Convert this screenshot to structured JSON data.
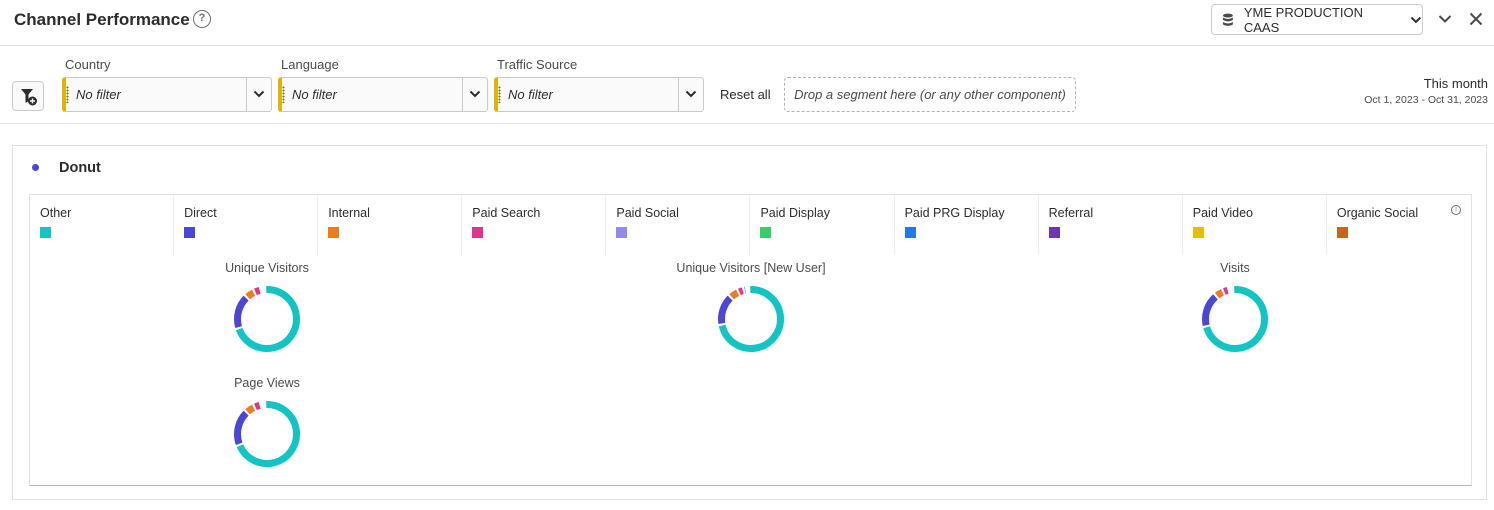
{
  "header": {
    "title": "Channel Performance",
    "help_glyph": "?",
    "datasource_label": "YME PRODUCTION CAAS"
  },
  "filters": {
    "items": [
      {
        "label": "Country",
        "value": "No filter"
      },
      {
        "label": "Language",
        "value": "No filter"
      },
      {
        "label": "Traffic Source",
        "value": "No filter"
      }
    ],
    "reset_label": "Reset all",
    "drop_zone": "Drop a segment here (or any other component)",
    "date_title": "This month",
    "date_range": "Oct 1, 2023 - Oct 31, 2023"
  },
  "panel": {
    "title": "Donut",
    "accent_color": "#4b47d6"
  },
  "legend": [
    {
      "label": "Other",
      "color": "#12c4c4"
    },
    {
      "label": "Direct",
      "color": "#4b47d6"
    },
    {
      "label": "Internal",
      "color": "#ec7d1f"
    },
    {
      "label": "Paid Search",
      "color": "#e0338a"
    },
    {
      "label": "Paid Social",
      "color": "#9389f5"
    },
    {
      "label": "Paid Display",
      "color": "#35d065"
    },
    {
      "label": "Paid PRG Display",
      "color": "#2479e8"
    },
    {
      "label": "Referral",
      "color": "#7134b3"
    },
    {
      "label": "Paid Video",
      "color": "#e3bf00"
    },
    {
      "label": "Organic Social",
      "color": "#c96516"
    }
  ],
  "info_glyph": "i",
  "chart_data": [
    {
      "type": "pie",
      "title": "Unique Visitors",
      "categories": [
        "Other",
        "Direct",
        "Internal",
        "Paid Search",
        "Paid Social",
        "Paid Display",
        "Paid PRG Display",
        "Referral",
        "Paid Video",
        "Organic Social"
      ],
      "values": [
        71,
        18,
        5,
        3.5,
        1,
        0.5,
        0.4,
        0.3,
        0.2,
        0.1
      ]
    },
    {
      "type": "pie",
      "title": "Unique Visitors [New User]",
      "categories": [
        "Other",
        "Direct",
        "Internal",
        "Paid Search",
        "Paid Social",
        "Paid Display",
        "Paid PRG Display",
        "Referral",
        "Paid Video",
        "Organic Social"
      ],
      "values": [
        73,
        16,
        5,
        3,
        1.5,
        0.5,
        0.4,
        0.3,
        0.2,
        0.1
      ]
    },
    {
      "type": "pie",
      "title": "Visits",
      "categories": [
        "Other",
        "Direct",
        "Internal",
        "Paid Search",
        "Paid Social",
        "Paid Display",
        "Paid PRG Display",
        "Referral",
        "Paid Video",
        "Organic Social"
      ],
      "values": [
        72,
        18,
        4.5,
        3,
        1,
        0.5,
        0.4,
        0.3,
        0.2,
        0.1
      ]
    },
    {
      "type": "pie",
      "title": "Page Views",
      "categories": [
        "Other",
        "Direct",
        "Internal",
        "Paid Search",
        "Paid Social",
        "Paid Display",
        "Paid PRG Display",
        "Referral",
        "Paid Video",
        "Organic Social"
      ],
      "values": [
        70,
        19,
        5,
        3.5,
        1,
        0.5,
        0.4,
        0.3,
        0.2,
        0.1
      ]
    }
  ]
}
